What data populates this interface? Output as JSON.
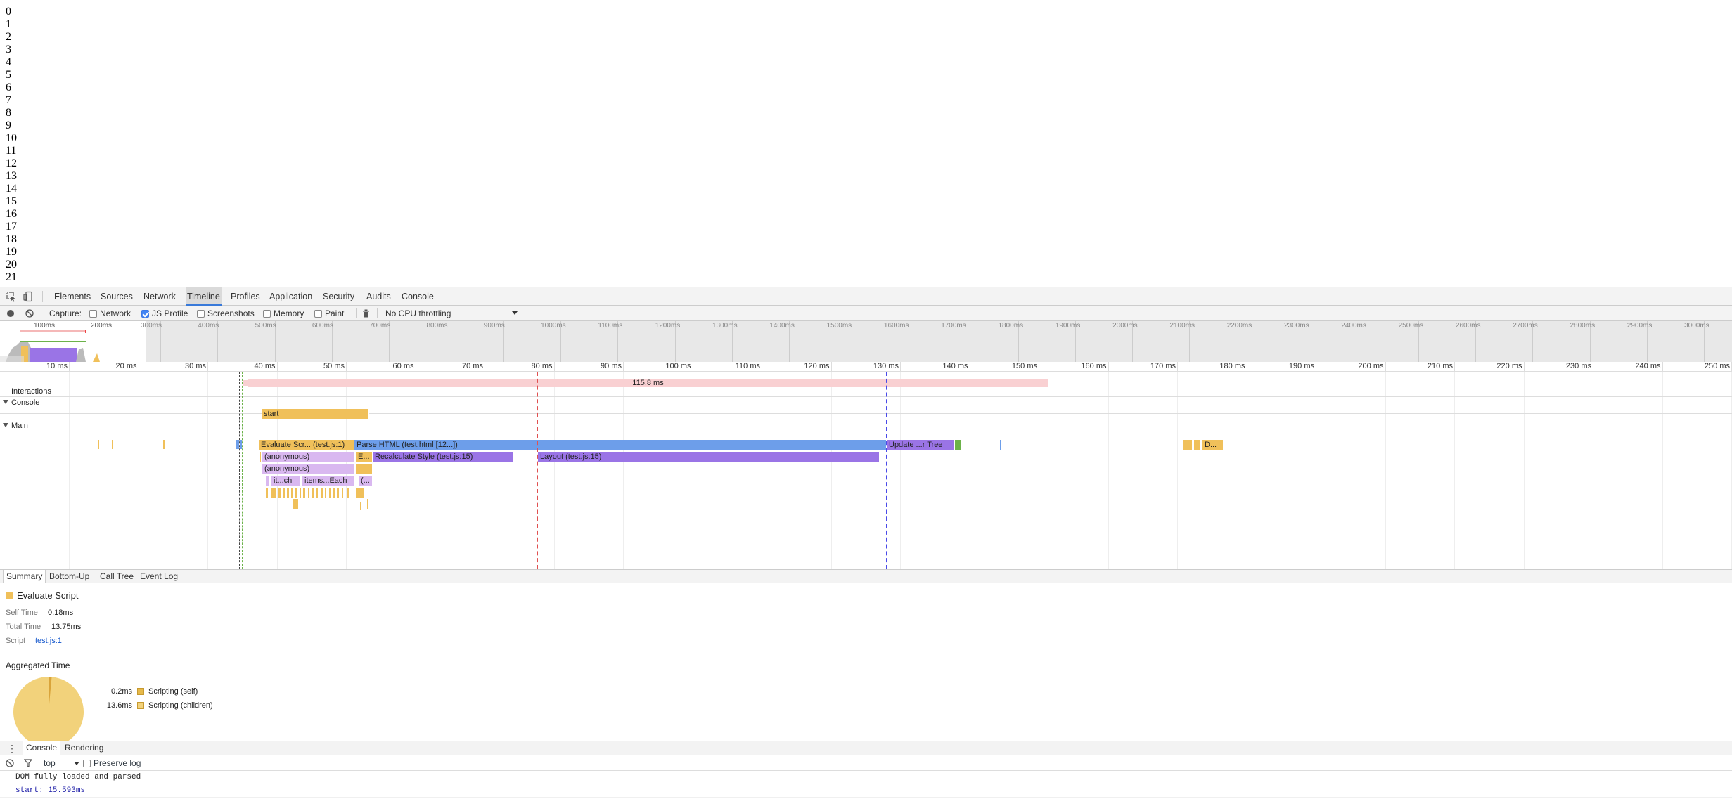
{
  "page": {
    "lines": [
      "0",
      "1",
      "2",
      "3",
      "4",
      "5",
      "6",
      "7",
      "8",
      "9",
      "10",
      "11",
      "12",
      "13",
      "14",
      "15",
      "16",
      "17",
      "18",
      "19",
      "20",
      "21"
    ]
  },
  "tabs": [
    {
      "label": "Elements"
    },
    {
      "label": "Sources"
    },
    {
      "label": "Network"
    },
    {
      "label": "Timeline",
      "selected": true
    },
    {
      "label": "Profiles"
    },
    {
      "label": "Application"
    },
    {
      "label": "Security"
    },
    {
      "label": "Audits"
    },
    {
      "label": "Console"
    }
  ],
  "toolbar": {
    "capture_label": "Capture:",
    "network_label": "Network",
    "network_checked": false,
    "js_profile_label": "JS Profile",
    "js_profile_checked": true,
    "screenshots_label": "Screenshots",
    "screenshots_checked": false,
    "memory_label": "Memory",
    "memory_checked": false,
    "paint_label": "Paint",
    "paint_checked": false,
    "throttling_value": "No CPU throttling"
  },
  "overview": {
    "left_ticks": [
      "100ms",
      "200ms"
    ],
    "ticks": [
      "300ms",
      "400ms",
      "500ms",
      "600ms",
      "700ms",
      "800ms",
      "900ms",
      "1000ms",
      "1100ms",
      "1200ms",
      "1300ms",
      "1400ms",
      "1500ms",
      "1600ms",
      "1700ms",
      "1800ms",
      "1900ms",
      "2000ms",
      "2100ms",
      "2200ms",
      "2300ms",
      "2400ms",
      "2500ms",
      "2600ms",
      "2700ms",
      "2800ms",
      "2900ms",
      "3000ms"
    ]
  },
  "ruler": {
    "ticks": [
      "10 ms",
      "20 ms",
      "30 ms",
      "40 ms",
      "50 ms",
      "60 ms",
      "70 ms",
      "80 ms",
      "90 ms",
      "100 ms",
      "110 ms",
      "120 ms",
      "130 ms",
      "140 ms",
      "150 ms",
      "160 ms",
      "170 ms",
      "180 ms",
      "190 ms",
      "200 ms",
      "210 ms",
      "220 ms",
      "230 ms",
      "240 ms",
      "250 ms"
    ]
  },
  "interactions": {
    "label": "Interactions",
    "duration": "115.8 ms"
  },
  "console_track": {
    "label": "Console",
    "start_label": "start"
  },
  "main_track": {
    "label": "Main",
    "bars": {
      "evaluate": "Evaluate Scr... (test.js:1)",
      "parse": "Parse HTML (test.html [12...])",
      "update": "Update ...r Tree",
      "d": "D...",
      "anon1": "(anonymous)",
      "e": "E...",
      "recalc": "Recalculate Style (test.js:15)",
      "layout": "Layout (test.js:15)",
      "anon2": "(anonymous)",
      "itch": "it...ch",
      "items": "items...Each",
      "paren": "(..."
    }
  },
  "summary_tabs": [
    {
      "label": "Summary",
      "selected": true
    },
    {
      "label": "Bottom-Up"
    },
    {
      "label": "Call Tree"
    },
    {
      "label": "Event Log"
    }
  ],
  "summary": {
    "title": "Evaluate Script",
    "self_time_label": "Self Time",
    "self_time": "0.18ms",
    "total_time_label": "Total Time",
    "total_time": "13.75ms",
    "script_label": "Script",
    "script_link": "test.js:1",
    "aggregated_title": "Aggregated Time",
    "legend": [
      {
        "value": "0.2ms",
        "label": "Scripting (self)",
        "color": "#e6b94a"
      },
      {
        "value": "13.6ms",
        "label": "Scripting (children)",
        "color": "#f2d27b"
      }
    ]
  },
  "pie_data": {
    "self": 0.2,
    "children": 13.6
  },
  "drawer": {
    "tabs": [
      {
        "label": "Console",
        "selected": true
      },
      {
        "label": "Rendering"
      }
    ],
    "context": "top",
    "preserve_log_label": "Preserve log",
    "messages": [
      {
        "text": "DOM fully loaded and parsed"
      },
      {
        "text": "start: 15.593ms",
        "color": "#1a1aa6"
      }
    ]
  },
  "colors": {
    "scripting": "#f0c05a",
    "rendering": "#9a74e6",
    "loading": "#6d9eea",
    "painting": "#6cb24a",
    "accent": "#3879d9",
    "interaction": "#f9d0d2"
  }
}
